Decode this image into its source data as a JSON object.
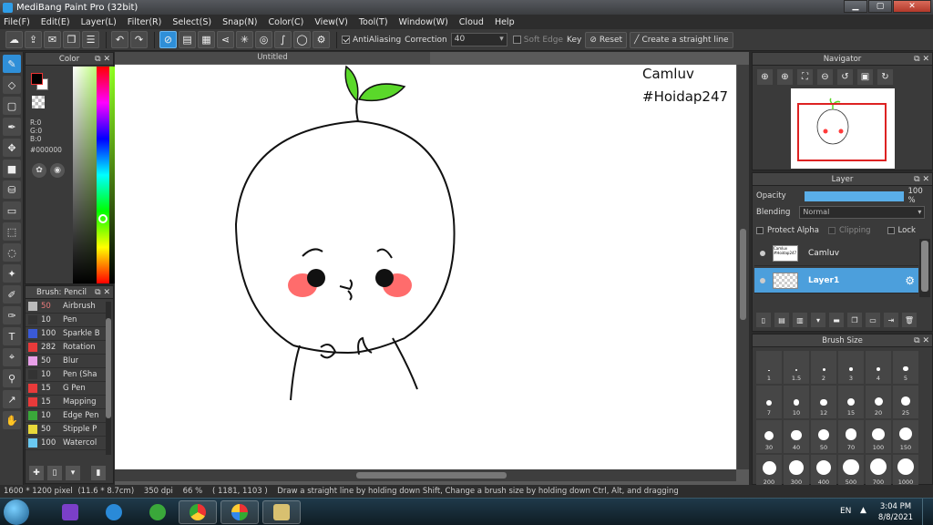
{
  "window": {
    "title": "MediBang Paint Pro (32bit)"
  },
  "menu": [
    "File(F)",
    "Edit(E)",
    "Layer(L)",
    "Filter(R)",
    "Select(S)",
    "Snap(N)",
    "Color(C)",
    "View(V)",
    "Tool(T)",
    "Window(W)",
    "Cloud",
    "Help"
  ],
  "toolbar": {
    "antialiasing_label": "AntiAliasing",
    "correction_label": "Correction",
    "correction_value": "40",
    "soft_edge_label": "Soft Edge",
    "key_label": "Key",
    "reset_label": "Reset",
    "straight_line_label": "Create a straight line"
  },
  "color_panel": {
    "title": "Color",
    "r": "R:0",
    "g": "G:0",
    "b": "B:0",
    "hex": "#000000",
    "foreground": "#000000",
    "background": "#ffffff"
  },
  "brush_panel": {
    "title": "Brush: Pencil",
    "items": [
      {
        "size": "50",
        "name": "Airbrush",
        "color": "#bbbbbb",
        "highlight": true
      },
      {
        "size": "10",
        "name": "Pen",
        "color": "#333333"
      },
      {
        "size": "100",
        "name": "Sparkle B",
        "color": "#3a5ad8"
      },
      {
        "size": "282",
        "name": "Rotation",
        "color": "#e83a3a"
      },
      {
        "size": "50",
        "name": "Blur",
        "color": "#e8a0e8"
      },
      {
        "size": "10",
        "name": "Pen (Sha",
        "color": "#333333"
      },
      {
        "size": "15",
        "name": "G Pen",
        "color": "#e83a3a"
      },
      {
        "size": "15",
        "name": "Mapping",
        "color": "#e83a3a"
      },
      {
        "size": "10",
        "name": "Edge Pen",
        "color": "#3aa83a"
      },
      {
        "size": "50",
        "name": "Stipple P",
        "color": "#e8d83a"
      },
      {
        "size": "100",
        "name": "Watercol",
        "color": "#6ac8f0"
      }
    ]
  },
  "document": {
    "tab": "Untitled",
    "watermark_line1": "Camluv",
    "watermark_line2": "#Hoidap247"
  },
  "navigator": {
    "title": "Navigator"
  },
  "layer_panel": {
    "title": "Layer",
    "opacity_label": "Opacity",
    "opacity_value": "100 %",
    "opacity": 1.0,
    "blending_label": "Blending",
    "blending_value": "Normal",
    "protect_alpha_label": "Protect Alpha",
    "clipping_label": "Clipping",
    "lock_label": "Lock",
    "layers": [
      {
        "name": "Camluv",
        "thumb": "Camluv #Hoidap247",
        "selected": false
      },
      {
        "name": "Layer1",
        "selected": true
      }
    ]
  },
  "brush_size_panel": {
    "title": "Brush Size",
    "sizes": [
      "1",
      "1.5",
      "2",
      "3",
      "4",
      "5",
      "7",
      "10",
      "12",
      "15",
      "20",
      "25",
      "30",
      "40",
      "50",
      "70",
      "100",
      "150",
      "200",
      "300",
      "400",
      "500",
      "700",
      "1000"
    ]
  },
  "status": {
    "dimensions": "1600 * 1200 pixel",
    "physical": "(11.6 * 8.7cm)",
    "dpi": "350 dpi",
    "zoom": "66 %",
    "cursor": "( 1181, 1103 )",
    "hint": "Draw a straight line by holding down Shift, Change a brush size by holding down Ctrl, Alt, and dragging"
  },
  "taskbar": {
    "language": "EN",
    "time": "3:04 PM",
    "date": "8/8/2021"
  },
  "colors": {
    "accent": "#2f8fd8",
    "layer_selected": "#4c9fdc",
    "sprout_green": "#5ad82a",
    "blush_red": "#ff3b3b"
  }
}
